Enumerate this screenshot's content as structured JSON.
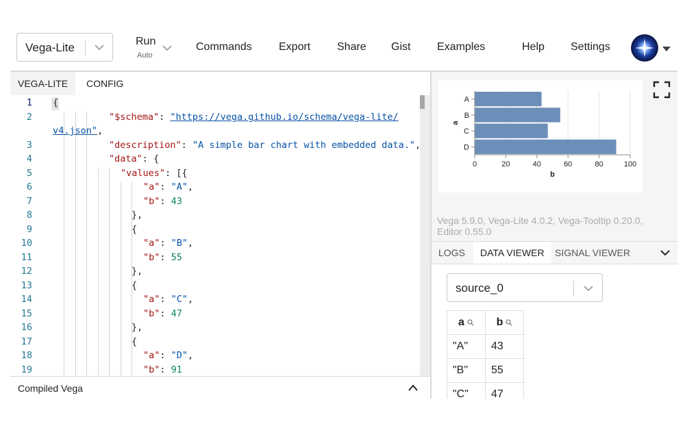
{
  "header": {
    "mode": "Vega-Lite",
    "run_label": "Run",
    "run_sub": "Auto",
    "nav": [
      "Commands",
      "Export",
      "Share",
      "Gist",
      "Examples",
      "Help",
      "Settings"
    ]
  },
  "editor": {
    "tabs": [
      "VEGA-LITE",
      "CONFIG"
    ],
    "line_numbers": [
      "1",
      "2",
      "",
      "3",
      "4",
      "5",
      "6",
      "7",
      "8",
      "9",
      "10",
      "11",
      "12",
      "13",
      "14",
      "15",
      "16",
      "17",
      "18",
      "19"
    ],
    "code": {
      "l1": "{",
      "schema_key": "\"$schema\"",
      "schema_url_a": "\"https://vega.github.io/schema/vega-lite/",
      "schema_url_b": "v4.json\"",
      "desc_key": "\"description\"",
      "desc_val": "\"A simple bar chart with embedded data.\"",
      "data_key": "\"data\"",
      "values_key": "\"values\"",
      "rows": [
        {
          "a": "\"A\"",
          "b": "43"
        },
        {
          "a": "\"B\"",
          "b": "55"
        },
        {
          "a": "\"C\"",
          "b": "47"
        },
        {
          "a": "\"D\"",
          "b": "91"
        }
      ],
      "a_key": "\"a\"",
      "b_key": "\"b\""
    },
    "compiled_label": "Compiled Vega"
  },
  "versions": "Vega 5.9.0, Vega-Lite 4.0.2, Vega-Tooltip 0.20.0, Editor 0.55.0",
  "debug_tabs": [
    "LOGS",
    "DATA VIEWER",
    "SIGNAL VIEWER"
  ],
  "data_viewer": {
    "source": "source_0",
    "columns": [
      "a",
      "b"
    ],
    "rows": [
      [
        "\"A\"",
        "43"
      ],
      [
        "\"B\"",
        "55"
      ],
      [
        "\"C\"",
        "47"
      ]
    ]
  },
  "colors": {
    "bar": "#6b8fb8",
    "key": "#a31515",
    "string": "#0451a5",
    "number": "#09885a",
    "linenum": "#237893"
  },
  "chart_data": {
    "type": "bar",
    "orientation": "horizontal",
    "categories": [
      "A",
      "B",
      "C",
      "D"
    ],
    "values": [
      43,
      55,
      47,
      91
    ],
    "xlabel": "b",
    "ylabel": "a",
    "xlim": [
      0,
      100
    ],
    "xticks": [
      "0",
      "20",
      "40",
      "60",
      "80",
      "100"
    ],
    "grid": true
  }
}
